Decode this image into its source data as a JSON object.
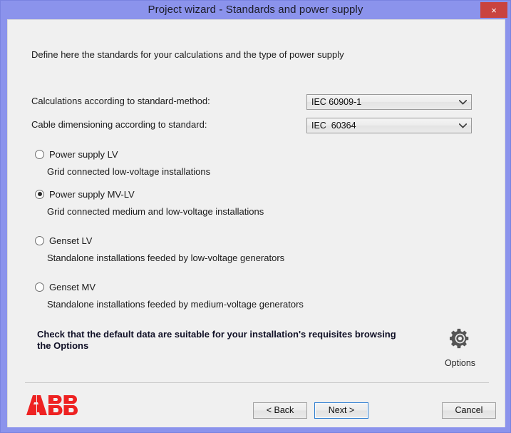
{
  "window": {
    "title": "Project wizard - Standards and power supply",
    "close_label": "×",
    "frame_color": "#8b93ec",
    "close_color": "#c9433f",
    "content_bg": "#f0f0f0"
  },
  "content": {
    "intro": "Define here the standards for your calculations and the type of power supply"
  },
  "form": {
    "rows": [
      {
        "label": "Calculations according to standard-method:",
        "value": "IEC 60909-1",
        "arrow": "chevron-down-icon"
      },
      {
        "label": "Cable dimensioning according to standard:",
        "value": "IEC  60364",
        "arrow": "chevron-down-icon"
      }
    ]
  },
  "power_supply": {
    "options": [
      {
        "label": "Power supply LV",
        "description": "Grid connected low-voltage installations",
        "selected": false
      },
      {
        "label": "Power supply MV-LV",
        "description": "Grid connected medium and low-voltage installations",
        "selected": true
      },
      {
        "label": "Genset LV",
        "description": "Standalone installations feeded by low-voltage generators",
        "selected": false
      },
      {
        "label": "Genset MV",
        "description": "Standalone installations feeded by medium-voltage generators",
        "selected": false
      }
    ]
  },
  "notice": {
    "text": "Check that the default data are suitable for your installation's requisites browsing the Options",
    "color": "#101026"
  },
  "options_button": {
    "icon": "gear-icon",
    "label": "Options",
    "icon_color": "#555555"
  },
  "branding": {
    "logo": "abb-logo",
    "logo_text": "ABB",
    "logo_color": "#ee2222"
  },
  "footer": {
    "back_label": "< Back",
    "next_label": "Next >",
    "cancel_label": "Cancel",
    "default_button": "Next >",
    "focus_color": "#2f7fd1"
  }
}
